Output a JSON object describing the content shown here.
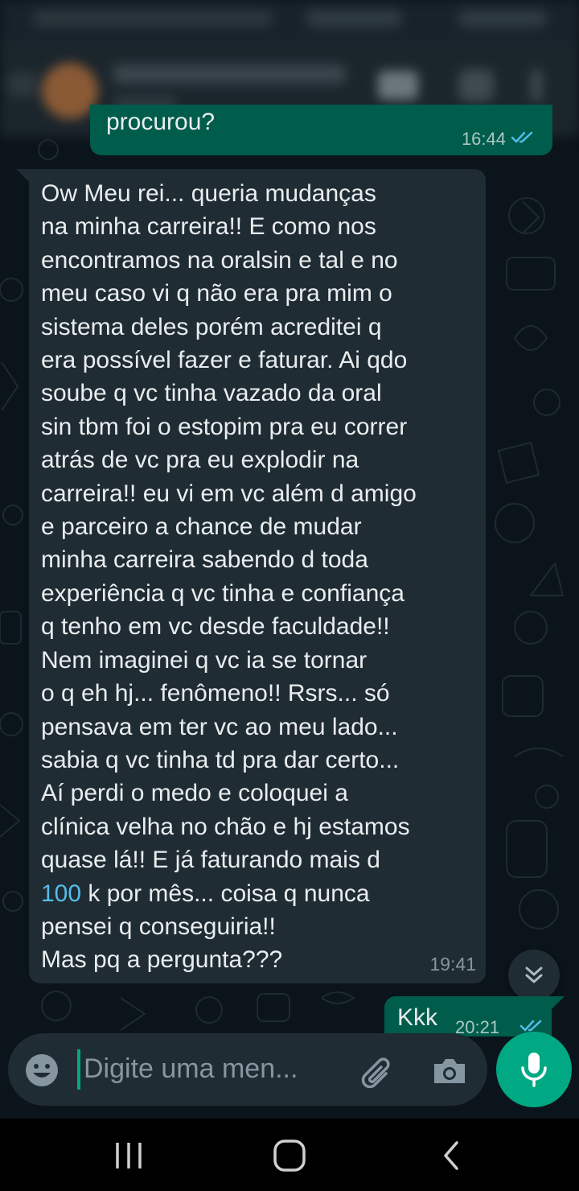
{
  "header": {
    "contact_name": "",
    "contact_status": ""
  },
  "messages": {
    "out_top": {
      "text": "procurou?",
      "time": "16:44",
      "status": "read"
    },
    "incoming": {
      "text_before_link": "Ow Meu rei... queria mudanças\nna minha carreira!! E como nos\nencontramos na oralsin e tal e no\nmeu caso vi q não era pra mim o\nsistema deles porém acreditei q\nera possível fazer e faturar. Ai qdo\nsoube q vc tinha vazado da oral\nsin tbm foi o estopim pra eu correr\natrás de vc pra eu explodir na\ncarreira!! eu vi em vc além d amigo\ne parceiro a chance de mudar\nminha carreira sabendo d toda\nexperiência q vc tinha e confiança\nq tenho em vc desde faculdade!!\nNem imaginei q vc ia se tornar\no q eh hj... fenômeno!! Rsrs... só\npensava em ter vc ao meu lado...\nsabia q vc tinha td pra dar certo...\nAí perdi o medo e coloquei a\nclínica velha no chão e hj estamos\nquase lá!! E já faturando mais d\n",
      "link_text": "100",
      "text_after_link": " k por mês... coisa q nunca\npensei q conseguiria!!\nMas pq a pergunta???",
      "time": "19:41"
    },
    "out_bottom": {
      "text": "Kkk",
      "time": "20:21",
      "status": "read"
    }
  },
  "composer": {
    "placeholder": "Digite uma men..."
  },
  "icons": {
    "emoji": "emoji-icon",
    "attach": "paperclip-icon",
    "camera": "camera-icon",
    "mic": "mic-icon",
    "scroll_down": "double-chevron-down-icon"
  },
  "colors": {
    "background": "#0b141a",
    "incoming_bubble": "#202c33",
    "outgoing_bubble": "#005c4b",
    "accent": "#00a884",
    "link": "#53bdeb",
    "read_ticks": "#53bdeb"
  }
}
